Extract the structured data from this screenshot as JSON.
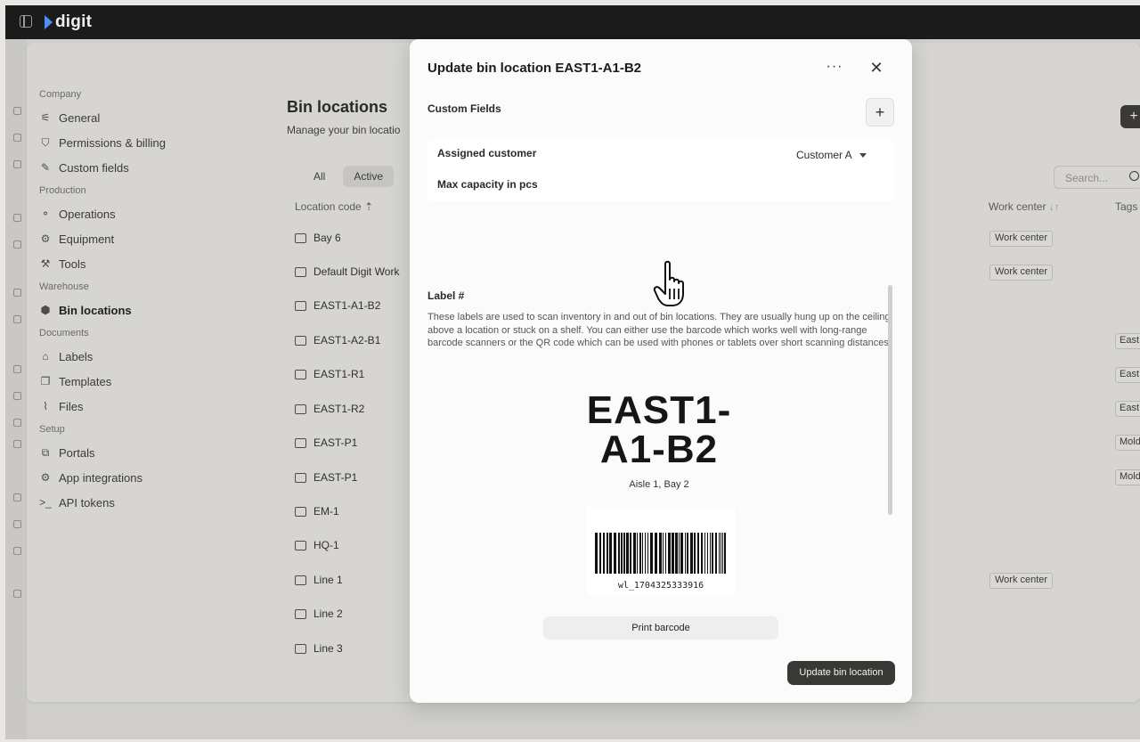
{
  "app": {
    "name": "digit"
  },
  "sidebar": {
    "sections": [
      {
        "title": "Company",
        "items": [
          {
            "label": "General",
            "icon": "sliders-icon"
          },
          {
            "label": "Permissions & billing",
            "icon": "shield-icon"
          },
          {
            "label": "Custom fields",
            "icon": "pencil-icon"
          }
        ]
      },
      {
        "title": "Production",
        "items": [
          {
            "label": "Operations",
            "icon": "flow-icon"
          },
          {
            "label": "Equipment",
            "icon": "equipment-icon"
          },
          {
            "label": "Tools",
            "icon": "wrench-icon"
          }
        ]
      },
      {
        "title": "Warehouse",
        "items": [
          {
            "label": "Bin locations",
            "icon": "box-icon",
            "active": true
          }
        ]
      },
      {
        "title": "Documents",
        "items": [
          {
            "label": "Labels",
            "icon": "tag-icon"
          },
          {
            "label": "Templates",
            "icon": "copy-icon"
          },
          {
            "label": "Files",
            "icon": "paperclip-icon"
          }
        ]
      },
      {
        "title": "Setup",
        "items": [
          {
            "label": "Portals",
            "icon": "portal-icon"
          },
          {
            "label": "App integrations",
            "icon": "gear-icon"
          },
          {
            "label": "API tokens",
            "icon": "terminal-icon"
          }
        ]
      }
    ]
  },
  "page": {
    "title": "Bin locations",
    "subtitle": "Manage your bin locatio",
    "tabs": [
      "All",
      "Active"
    ],
    "search_placeholder": "Search...",
    "columns": {
      "location_code": "Location code",
      "work_center": "Work center",
      "tags": "Tags"
    },
    "rows": [
      {
        "code": "Bay 6",
        "work_center": "Work center",
        "tag": ""
      },
      {
        "code": "Default Digit Work",
        "work_center": "Work center",
        "tag": ""
      },
      {
        "code": "EAST1-A1-B2",
        "work_center": "",
        "tag": ""
      },
      {
        "code": "EAST1-A2-B1",
        "work_center": "",
        "tag": "East"
      },
      {
        "code": "EAST1-R1",
        "work_center": "",
        "tag": "East"
      },
      {
        "code": "EAST1-R2",
        "work_center": "",
        "tag": "East"
      },
      {
        "code": "EAST-P1",
        "work_center": "",
        "tag": "Mold"
      },
      {
        "code": "EAST-P1",
        "work_center": "",
        "tag": "Mold"
      },
      {
        "code": "EM-1",
        "work_center": "",
        "tag": ""
      },
      {
        "code": "HQ-1",
        "work_center": "",
        "tag": ""
      },
      {
        "code": "Line 1",
        "work_center": "Work center",
        "tag": ""
      },
      {
        "code": "Line 2",
        "work_center": "",
        "tag": ""
      },
      {
        "code": "Line 3",
        "work_center": "",
        "tag": ""
      }
    ]
  },
  "modal": {
    "title": "Update bin location EAST1-A1-B2",
    "more_label": "···",
    "close_label": "✕",
    "custom_fields_label": "Custom Fields",
    "add_field_label": "+",
    "fields": [
      {
        "name": "Assigned customer",
        "value": "Customer A"
      },
      {
        "name": "Max capacity in pcs",
        "value": ""
      }
    ],
    "label_heading": "Label #",
    "label_description": "These labels are used to scan inventory in and out of bin locations. They are usually hung up on the ceiling above a location or stuck on a shelf. You can either use the barcode which works well with long-range barcode scanners or the QR code which can be used with phones or tablets over short scanning distances.",
    "label_code_line1": "EAST1-",
    "label_code_line2": "A1-B2",
    "label_code_sub": "Aisle 1, Bay 2",
    "barcode_text": "wl_1704325333916",
    "print_button": "Print barcode",
    "submit_button": "Update bin location"
  }
}
